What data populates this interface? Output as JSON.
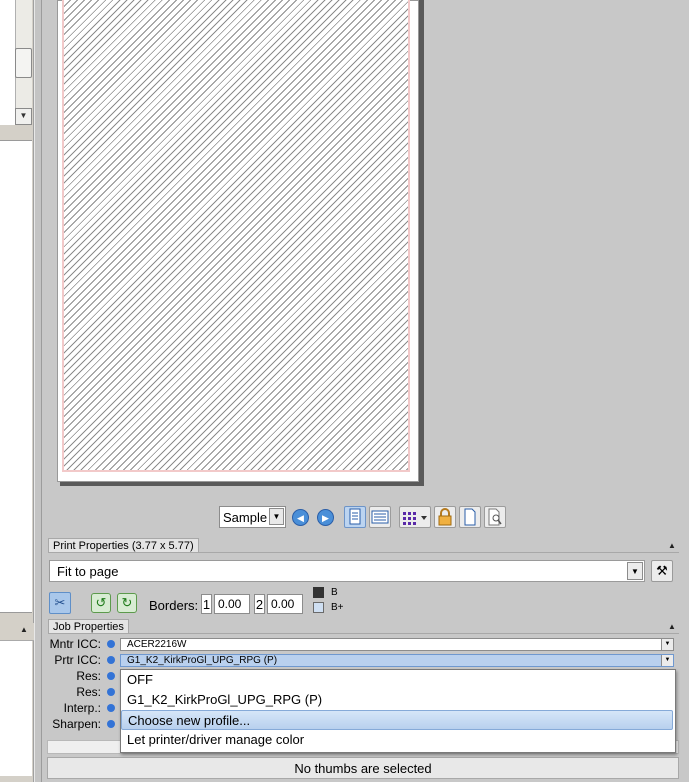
{
  "preview": {
    "mode_select": "Sample"
  },
  "toolbar": {
    "icons": [
      "previous-icon",
      "next-icon",
      "page-view-icon",
      "list-view-icon",
      "grid-layout-icon",
      "lock-icon",
      "blank-page-icon",
      "zoom-page-icon"
    ]
  },
  "print_properties": {
    "title": "Print Properties (3.77 x 5.77)",
    "fit_value": "Fit to page",
    "borders_label": "Borders:",
    "border1_label": "1",
    "border1_value": "0.00",
    "border2_label": "2",
    "border2_value": "0.00",
    "opt_b": "B",
    "opt_bplus": "B+"
  },
  "job_properties": {
    "title": "Job Properties",
    "rows": [
      {
        "label": "Mntr ICC:",
        "value": "ACER2216W"
      },
      {
        "label": "Prtr ICC:",
        "value": "G1_K2_KirkProGl_UPG_RPG (P)"
      },
      {
        "label": "Res:"
      },
      {
        "label": "Res:"
      },
      {
        "label": "Interp.:"
      },
      {
        "label": "Sharpen:"
      }
    ]
  },
  "dropdown": {
    "items": [
      "OFF",
      "G1_K2_KirkProGl_UPG_RPG (P)",
      "Choose new profile...",
      "Let printer/driver manage color"
    ],
    "highlighted_index": 2
  },
  "status": {
    "text": "No thumbs are selected"
  },
  "colors": {
    "accent": "#3373d6",
    "highlight": "#b8d0ee",
    "background": "#c8c8c8"
  }
}
